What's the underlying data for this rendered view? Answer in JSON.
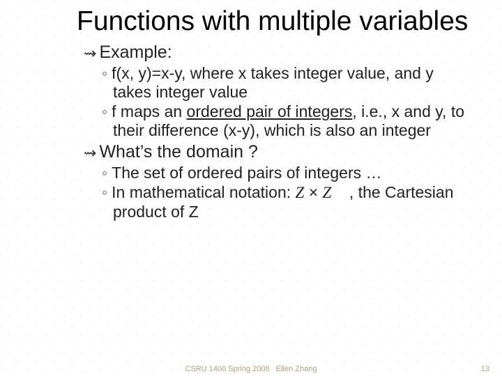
{
  "slide": {
    "title": "Functions with multiple variables",
    "sections": [
      {
        "heading": "Example:",
        "bullets": [
          "f(x, y)=x-y, where x takes integer value, and y takes integer value",
          "f maps an ordered pair of integers, i.e., x and y, to their difference (x-y), which is also an integer"
        ]
      },
      {
        "heading": "What’s the domain ?",
        "bullets": [
          "The set of ordered pairs of integers …",
          "In mathematical notation: Z × Z , the Cartesian product of Z"
        ]
      }
    ],
    "ordered_pair_phrase": "ordered pair of integers",
    "math_fragment": {
      "Z": "Z",
      "times": "×"
    },
    "footer": {
      "course": "CSRU 1400 Spring 2008",
      "author": "Ellen Zhang",
      "page": "13"
    }
  },
  "lvl1_bullet_glyph": "⇝",
  "lvl2_bullet_glyph": "◦"
}
